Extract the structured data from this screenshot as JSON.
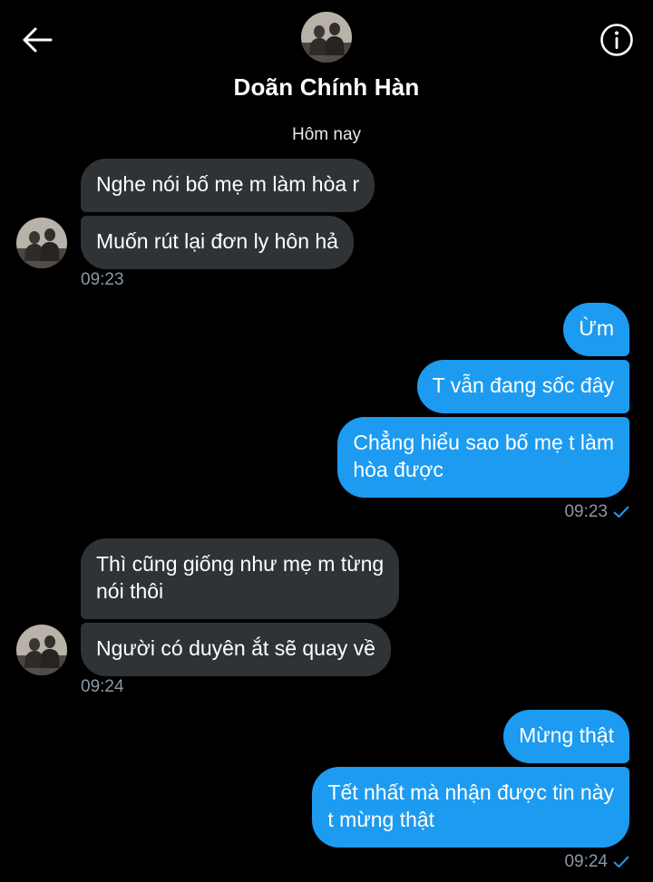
{
  "header": {
    "contact_name": "Doãn Chính Hàn",
    "back_icon": "arrow-left-icon",
    "info_icon": "info-circle-icon"
  },
  "conversation": {
    "day_separator": "Hôm nay",
    "groups": [
      {
        "direction": "incoming",
        "messages": [
          "Nghe nói bố mẹ m làm hòa r",
          "Muốn rút lại đơn ly hôn hả"
        ],
        "time": "09:23"
      },
      {
        "direction": "outgoing",
        "messages": [
          "Ừm",
          "T vẫn đang sốc đây",
          "Chẳng hiểu sao bố mẹ t làm",
          "hòa được"
        ],
        "time": "09:23",
        "status_icon": "sent-check-icon"
      },
      {
        "direction": "incoming",
        "messages": [
          "Thì cũng giống như mẹ m từng",
          "nói thôi",
          "Người có duyên ắt sẽ quay về"
        ],
        "time": "09:24"
      },
      {
        "direction": "outgoing",
        "messages": [
          "Mừng thật",
          "Tết nhất mà nhận được tin này",
          "t mừng thật"
        ],
        "time": "09:24",
        "status_icon": "sent-check-icon"
      }
    ]
  },
  "colors": {
    "background": "#000000",
    "incoming_bubble": "#2f3336",
    "outgoing_bubble": "#1d9bf0",
    "timestamp": "#8b98a5",
    "check": "#1d9bf0"
  }
}
